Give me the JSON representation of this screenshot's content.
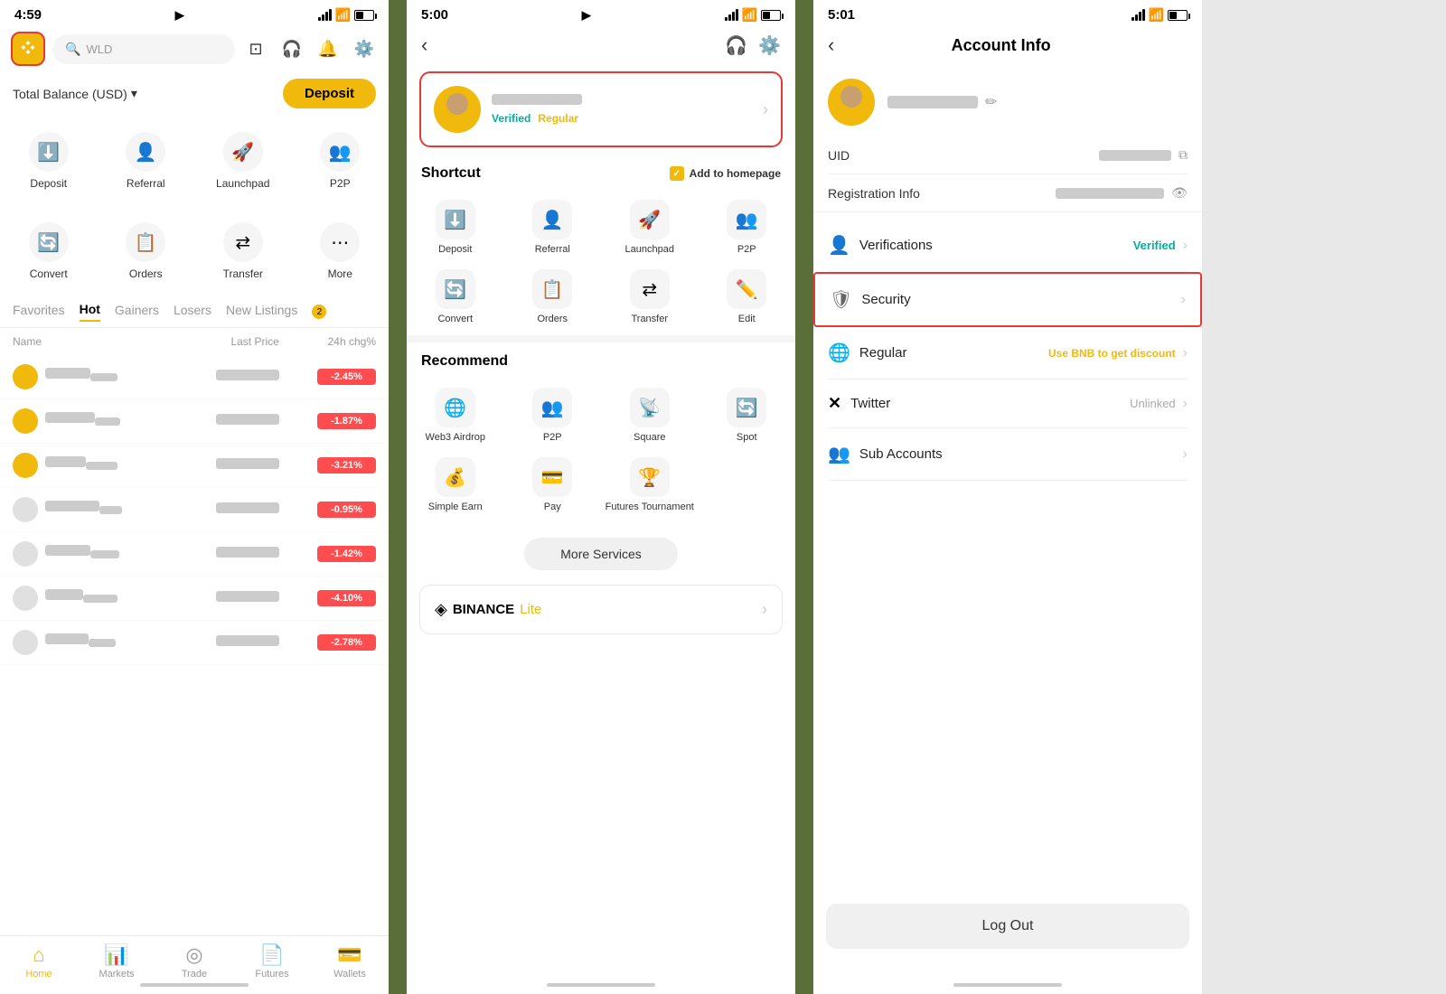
{
  "phone1": {
    "status": {
      "time": "4:59",
      "nav_arrow": "▶"
    },
    "header": {
      "search_placeholder": "WLD"
    },
    "balance": {
      "label": "Total Balance (USD)",
      "deposit_btn": "Deposit"
    },
    "grid1": [
      {
        "label": "Deposit",
        "icon": "⬇️"
      },
      {
        "label": "Referral",
        "icon": "👤"
      },
      {
        "label": "Launchpad",
        "icon": "🚀"
      },
      {
        "label": "P2P",
        "icon": "👥"
      }
    ],
    "grid2": [
      {
        "label": "Convert",
        "icon": "🔄"
      },
      {
        "label": "Orders",
        "icon": "📋"
      },
      {
        "label": "Transfer",
        "icon": "⇄"
      },
      {
        "label": "More",
        "icon": "⋯"
      }
    ],
    "tabs": [
      {
        "label": "Favorites",
        "active": false
      },
      {
        "label": "Hot",
        "active": true
      },
      {
        "label": "Gainers",
        "active": false
      },
      {
        "label": "Losers",
        "active": false
      },
      {
        "label": "New Listings",
        "active": false
      },
      {
        "label": "2",
        "active": false
      }
    ],
    "table_headers": {
      "name": "Name",
      "last_price": "Last Price",
      "change": "24h chg%"
    },
    "rows": [
      {
        "has_yellow": true
      },
      {
        "has_yellow": true
      },
      {
        "has_yellow": true
      },
      {
        "has_yellow": false
      },
      {
        "has_yellow": false
      },
      {
        "has_yellow": false
      },
      {
        "has_yellow": false
      }
    ],
    "bottom_nav": [
      {
        "label": "Home",
        "active": true,
        "icon": "⌂"
      },
      {
        "label": "Markets",
        "active": false,
        "icon": "📊"
      },
      {
        "label": "Trade",
        "active": false,
        "icon": "◎"
      },
      {
        "label": "Futures",
        "active": false,
        "icon": "📄"
      },
      {
        "label": "Wallets",
        "active": false,
        "icon": "💳"
      }
    ]
  },
  "phone2": {
    "status": {
      "time": "5:00"
    },
    "profile": {
      "verified_label": "Verified",
      "regular_label": "Regular"
    },
    "shortcut_label": "Shortcut",
    "add_to_homepage": "Add to homepage",
    "shortcut_items": [
      {
        "label": "Deposit"
      },
      {
        "label": "Referral"
      },
      {
        "label": "Launchpad"
      },
      {
        "label": "P2P"
      },
      {
        "label": "Convert"
      },
      {
        "label": "Orders"
      },
      {
        "label": "Transfer"
      },
      {
        "label": "Edit"
      }
    ],
    "recommend_label": "Recommend",
    "recommend_items": [
      {
        "label": "Web3 Airdrop"
      },
      {
        "label": "P2P"
      },
      {
        "label": "Square"
      },
      {
        "label": "Spot"
      },
      {
        "label": "Simple Earn"
      },
      {
        "label": "Pay"
      },
      {
        "label": "Futures Tournament"
      }
    ],
    "more_services_btn": "More Services",
    "binance_lite": {
      "brand": "BINANCE",
      "mode": "Lite"
    }
  },
  "phone3": {
    "status": {
      "time": "5:01"
    },
    "title": "Account Info",
    "uid_label": "UID",
    "registration_label": "Registration Info",
    "menu_items": [
      {
        "icon": "👤",
        "label": "Verifications",
        "value": "Verified",
        "value_type": "green"
      },
      {
        "icon": "🛡",
        "label": "Security",
        "value": "",
        "value_type": "none",
        "highlighted": true
      },
      {
        "icon": "🌐",
        "label": "Regular",
        "value": "Use BNB to get discount",
        "value_type": "yellow"
      },
      {
        "icon": "✕",
        "label": "Twitter",
        "value": "Unlinked",
        "value_type": "gray"
      },
      {
        "icon": "👥",
        "label": "Sub Accounts",
        "value": "",
        "value_type": "none"
      }
    ],
    "logout_btn": "Log Out"
  }
}
